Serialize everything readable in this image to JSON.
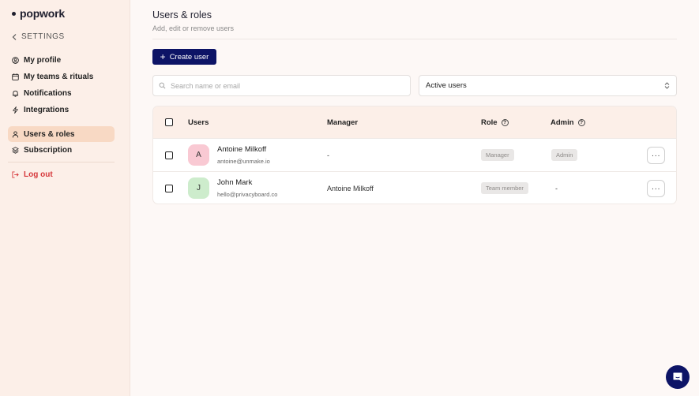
{
  "brand": {
    "name": "popwork"
  },
  "sidebar": {
    "back_label": "SETTINGS",
    "items": [
      {
        "label": "My profile",
        "icon": "user-circle-icon"
      },
      {
        "label": "My teams & rituals",
        "icon": "calendar-icon"
      },
      {
        "label": "Notifications",
        "icon": "bell-icon"
      },
      {
        "label": "Integrations",
        "icon": "lightning-icon"
      },
      {
        "label": "Users & roles",
        "icon": "user-icon",
        "active": true
      },
      {
        "label": "Subscription",
        "icon": "layers-icon"
      }
    ],
    "logout_label": "Log out"
  },
  "page": {
    "title": "Users & roles",
    "subtitle": "Add, edit or remove users",
    "create_button": "Create user"
  },
  "filters": {
    "search_placeholder": "Search name or email",
    "status_value": "Active users"
  },
  "table": {
    "headers": {
      "users": "Users",
      "manager": "Manager",
      "role": "Role",
      "admin": "Admin"
    },
    "rows": [
      {
        "initial": "A",
        "name": "Antoine Milkoff",
        "email": "antoine@unmake.io",
        "manager": "-",
        "role": "Manager",
        "admin": "Admin",
        "avatar_color": "#f9c9d3"
      },
      {
        "initial": "J",
        "name": "John Mark",
        "email": "hello@privacyboard.co",
        "manager": "Antoine Milkoff",
        "role": "Team member",
        "admin": "-",
        "avatar_color": "#cdeccc"
      }
    ]
  },
  "colors": {
    "accent": "#0d1466",
    "sidebar_bg": "#fcefe8",
    "active_bg": "#f8d9c4",
    "danger": "#d6373a"
  }
}
